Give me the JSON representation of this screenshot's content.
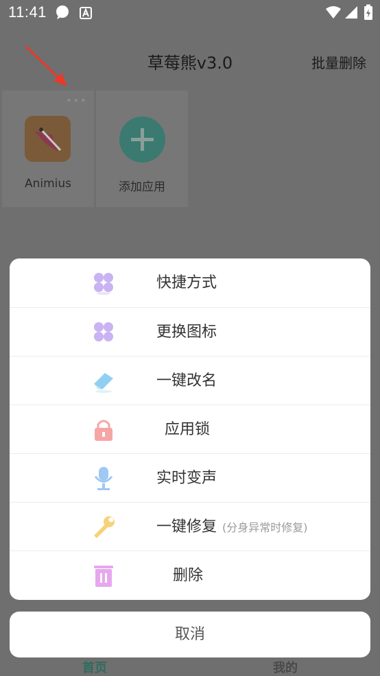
{
  "status_bar": {
    "time": "11:41"
  },
  "header": {
    "title": "草莓熊v3.0",
    "batch_delete_label": "批量删除"
  },
  "apps": [
    {
      "label": "Animius"
    },
    {
      "label": "添加应用"
    }
  ],
  "action_sheet": {
    "items": [
      {
        "label": "快捷方式",
        "icon": "clover-icon"
      },
      {
        "label": "更换图标",
        "icon": "clover-icon"
      },
      {
        "label": "一键改名",
        "icon": "eraser-icon"
      },
      {
        "label": "应用锁",
        "icon": "lock-icon"
      },
      {
        "label": "实时变声",
        "icon": "microphone-icon"
      },
      {
        "label": "一键修复",
        "sublabel": "(分身异常时修复)",
        "icon": "wrench-icon"
      },
      {
        "label": "删除",
        "icon": "trash-icon"
      }
    ],
    "cancel_label": "取消"
  },
  "bottom_nav": {
    "home_label": "首页",
    "mine_label": "我的"
  },
  "colors": {
    "overlay": "#6f6f6f",
    "clover": "#c9b3f2",
    "eraser": "#8fd0f2",
    "lock": "#f6a5a5",
    "mic": "#9fc8f2",
    "wrench": "#f6d27a",
    "trash": "#e7a7ee",
    "add_button": "#3a7a70"
  }
}
